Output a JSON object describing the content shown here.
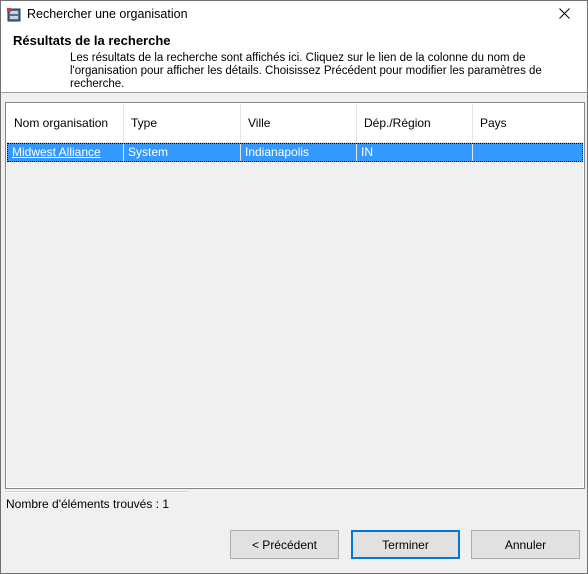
{
  "window": {
    "title": "Rechercher une organisation",
    "app_icon": "db-app-icon",
    "close_icon": "close-icon"
  },
  "header": {
    "title": "Résultats de la recherche",
    "description": "Les résultats de la recherche sont affichés ici. Cliquez sur le lien de la colonne du nom de l'organisation pour afficher les détails. Choisissez Précédent pour modifier les paramètres de recherche."
  },
  "table": {
    "columns": [
      "Nom organisation",
      "Type",
      "Ville",
      "Dép./Région",
      "Pays"
    ],
    "rows": [
      [
        "Midwest Alliance",
        "System",
        "Indianapolis",
        "IN",
        ""
      ]
    ],
    "selected_row_color": "#3399ff"
  },
  "status": {
    "count_label": "Nombre d'éléments trouvés : 1"
  },
  "buttons": {
    "back_label": "< Précédent",
    "finish_label": "Terminer",
    "cancel_label": "Annuler"
  },
  "colors": {
    "accent": "#0078d7",
    "selection": "#3399ff"
  }
}
